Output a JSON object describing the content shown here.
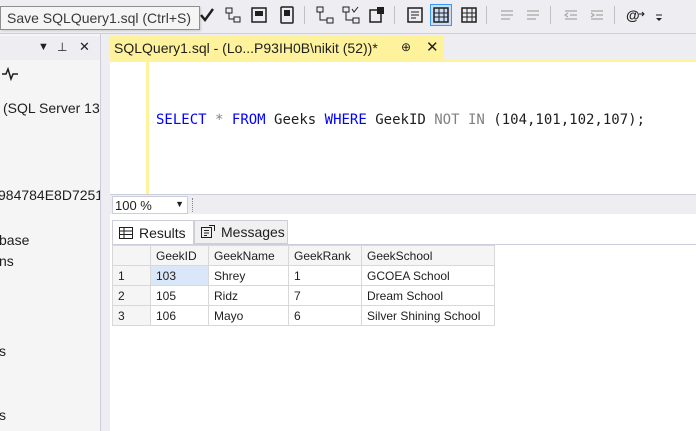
{
  "tooltip": "Save SQLQuery1.sql (Ctrl+S)",
  "explorer": {
    "server_text": "(SQL Server 13",
    "hash_text": "984784E8D7251",
    "line_base": "base",
    "line_ns": "ns",
    "line_s1": "s",
    "line_s2": "s"
  },
  "document_tab": {
    "title": "SQLQuery1.sql - (Lo...P93IH0B\\nikit (52))*",
    "pin_glyph": "⊕",
    "close_glyph": "✕"
  },
  "editor": {
    "kw_select": "SELECT",
    "star": "*",
    "kw_from": "FROM",
    "table": "Geeks",
    "kw_where": "WHERE",
    "column": "GeekID",
    "kw_not": "NOT",
    "kw_in": "IN",
    "values": "(104,101,102,107);"
  },
  "zoom": {
    "value": "100 %"
  },
  "results_tabs": {
    "results_label": "Results",
    "messages_label": "Messages"
  },
  "grid": {
    "columns": [
      "GeekID",
      "GeekName",
      "GeekRank",
      "GeekSchool"
    ],
    "rows": [
      {
        "num": "1",
        "cells": [
          "103",
          "Shrey",
          "1",
          "GCOEA School"
        ]
      },
      {
        "num": "2",
        "cells": [
          "105",
          "Ridz",
          "7",
          "Dream School"
        ]
      },
      {
        "num": "3",
        "cells": [
          "106",
          "Mayo",
          "6",
          "Silver Shining School"
        ]
      }
    ]
  },
  "colors": {
    "tab_yellow": "#fff29d",
    "keyword_blue": "#0000ff",
    "operator_gray": "#808080",
    "chrome": "#eeeef2",
    "selected_cell": "#d9e7f8"
  }
}
